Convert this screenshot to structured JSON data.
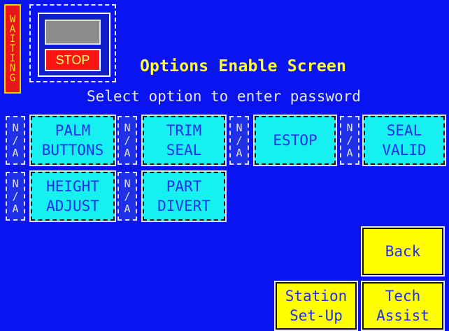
{
  "status": {
    "waiting_label": "WAITING",
    "stop_label": "STOP"
  },
  "header": {
    "title": "Options Enable Screen",
    "subtitle": "Select option to enter password"
  },
  "na_label": [
    "N",
    "A"
  ],
  "options": [
    {
      "line1": "PALM",
      "line2": "BUTTONS"
    },
    {
      "line1": "TRIM",
      "line2": "SEAL"
    },
    {
      "line1": "ESTOP",
      "line2": ""
    },
    {
      "line1": "SEAL",
      "line2": "VALID"
    },
    {
      "line1": "HEIGHT",
      "line2": "ADJUST"
    },
    {
      "line1": "PART",
      "line2": "DIVERT"
    }
  ],
  "buttons": {
    "back": "Back",
    "station_line1": "Station",
    "station_line2": "Set-Up",
    "tech_line1": "Tech",
    "tech_line2": "Assist"
  },
  "colors": {
    "background": "#0a14f0",
    "option_tile": "#16f0f0",
    "title": "#ffff33",
    "button": "#ffff00",
    "stop": "#ff1414"
  }
}
